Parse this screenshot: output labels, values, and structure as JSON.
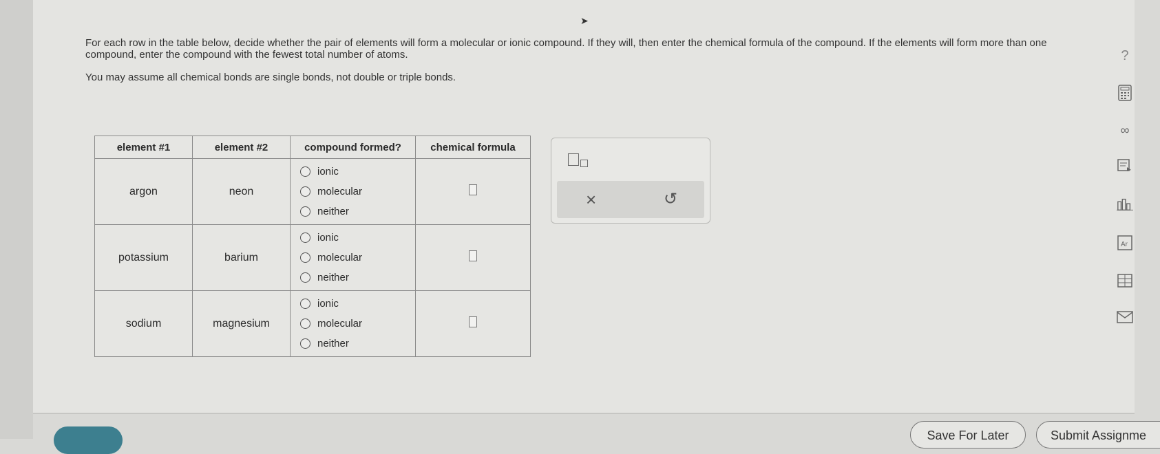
{
  "instructions": {
    "line1": "For each row in the table below, decide whether the pair of elements will form a molecular or ionic compound. If they will, then enter the chemical formula of the compound. If the elements will form more than one compound, enter the compound with the fewest total number of atoms.",
    "line2": "You may assume all chemical bonds are single bonds, not double or triple bonds."
  },
  "table": {
    "headers": [
      "element #1",
      "element #2",
      "compound formed?",
      "chemical formula"
    ],
    "options": [
      "ionic",
      "molecular",
      "neither"
    ],
    "rows": [
      {
        "el1": "argon",
        "el2": "neon"
      },
      {
        "el1": "potassium",
        "el2": "barium"
      },
      {
        "el1": "sodium",
        "el2": "magnesium"
      }
    ]
  },
  "tools": {
    "clear": "×",
    "undo": "↺"
  },
  "sidebar": {
    "help": "?"
  },
  "footer": {
    "save": "Save For Later",
    "submit": "Submit Assignme"
  }
}
